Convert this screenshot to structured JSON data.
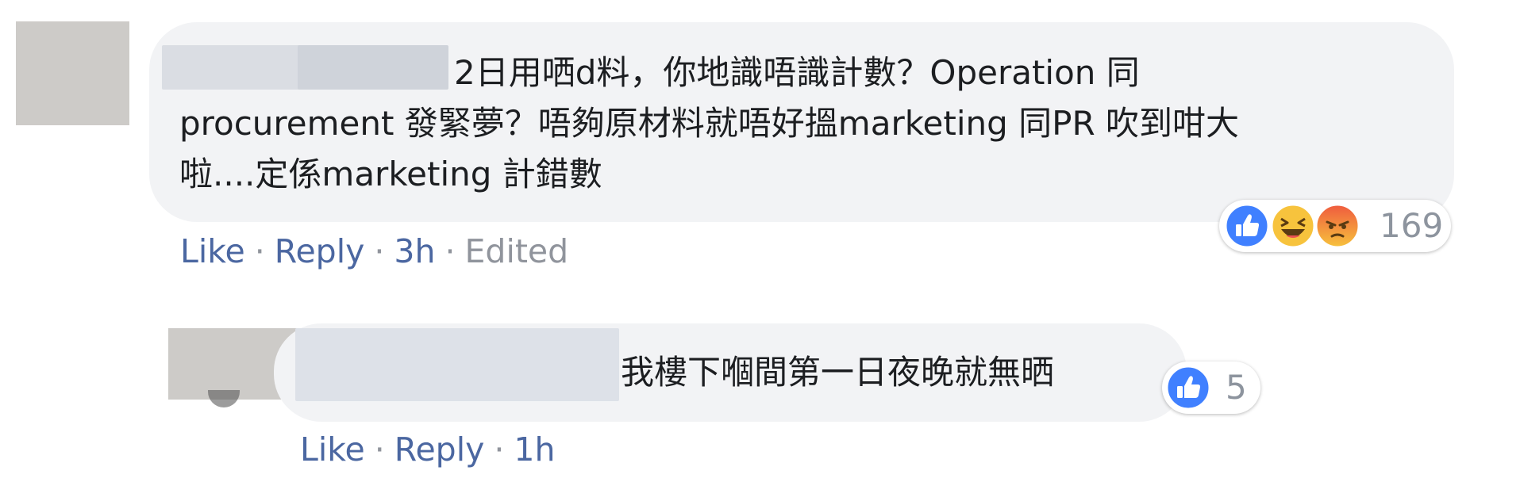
{
  "comment": {
    "text_lines": [
      "2日用哂d料，你地識唔識計數？Operation 同",
      "procurement 發緊夢？唔夠原材料就唔好搵marketing 同PR 吹到咁大",
      "啦....定係marketing 計錯數"
    ],
    "reactions": {
      "icons": [
        "like-icon",
        "haha-icon",
        "angry-icon"
      ],
      "count": "169"
    },
    "actions": {
      "like_label": "Like",
      "reply_label": "Reply",
      "time": "3h",
      "edited_label": "Edited",
      "separator": "·"
    }
  },
  "reply": {
    "text": "我樓下嗰間第一日夜晚就無晒",
    "reactions": {
      "icons": [
        "like-icon"
      ],
      "count": "5"
    },
    "actions": {
      "like_label": "Like",
      "reply_label": "Reply",
      "time": "1h",
      "separator": "·"
    }
  },
  "colors": {
    "bubble": "#f2f3f5",
    "link": "#4b67a1",
    "muted": "#90949c",
    "like_blue": "#4080ff",
    "haha_yellow": "#f7c33d",
    "angry_orange": "#f08a3a"
  }
}
